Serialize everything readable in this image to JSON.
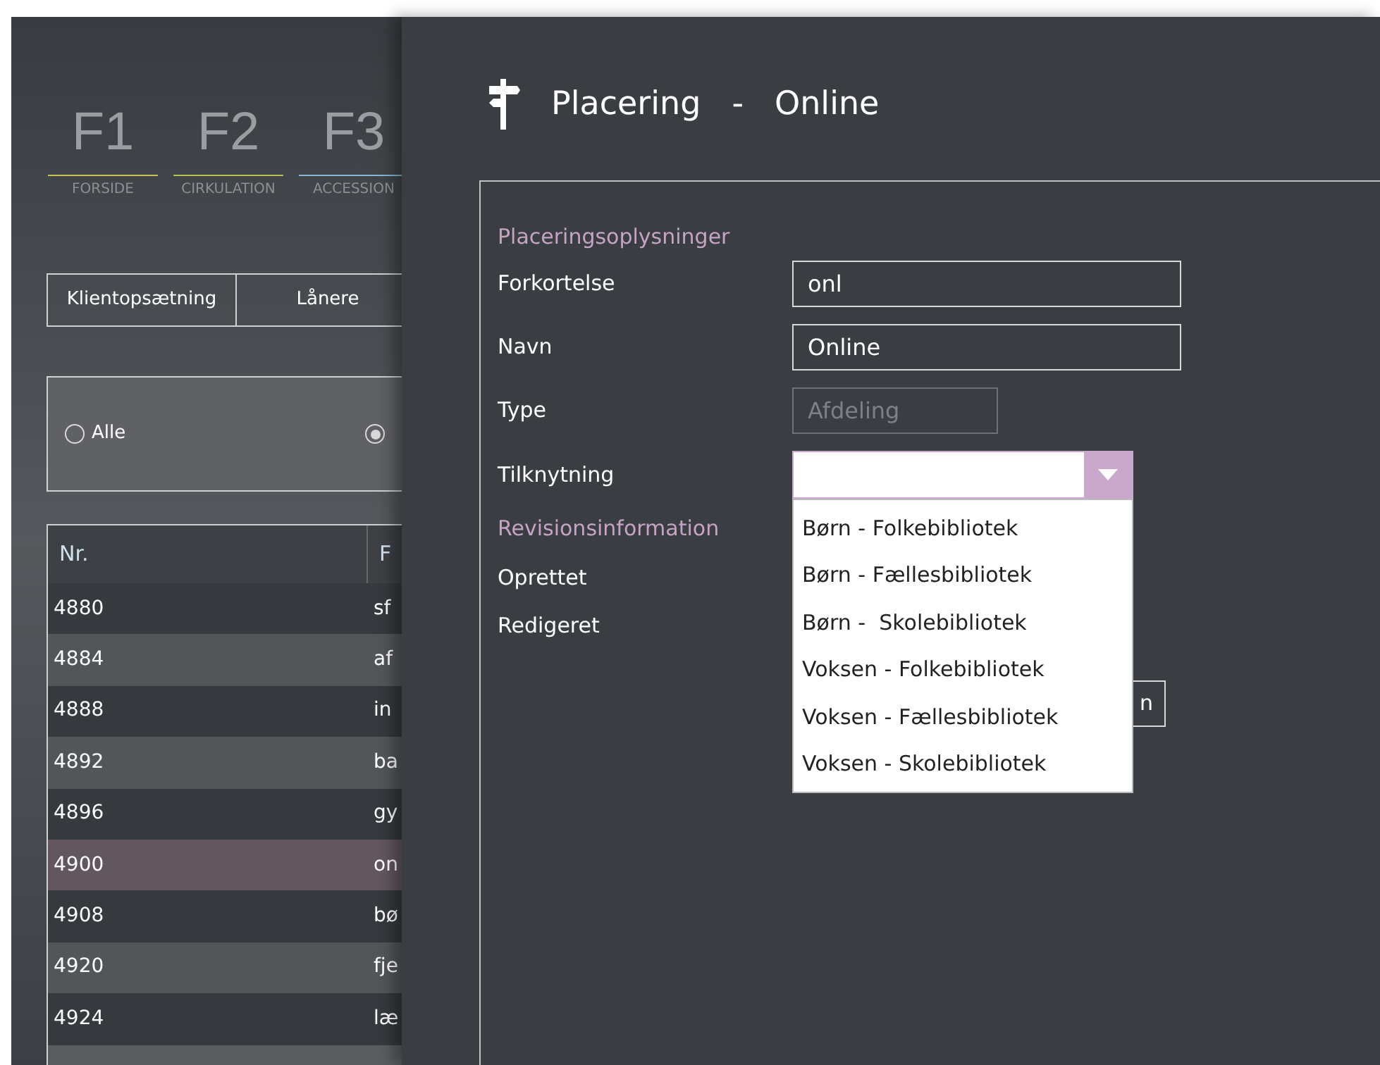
{
  "nav": {
    "keys": [
      {
        "key": "F1",
        "label": "FORSIDE",
        "color": "#c9c24f"
      },
      {
        "key": "F2",
        "label": "CIRKULATION",
        "color": "#b5c24a"
      },
      {
        "key": "F3",
        "label": "ACCESSION",
        "color": "#86b6d6"
      }
    ]
  },
  "tabs": [
    {
      "label": "Klientopsætning",
      "selected": false
    },
    {
      "label": "Lånere",
      "selected": false
    }
  ],
  "filter": [
    {
      "label": "Alle",
      "selected": false
    },
    {
      "selected": true
    }
  ],
  "table": {
    "columns": [
      "Nr.",
      "F"
    ],
    "rows": [
      {
        "cells": [
          "4880",
          "sf"
        ],
        "selected": false
      },
      {
        "cells": [
          "4884",
          "af"
        ],
        "selected": false
      },
      {
        "cells": [
          "4888",
          "in"
        ],
        "selected": false
      },
      {
        "cells": [
          "4892",
          "ba"
        ],
        "selected": false
      },
      {
        "cells": [
          "4896",
          "gy"
        ],
        "selected": false
      },
      {
        "cells": [
          "4900",
          "on"
        ],
        "selected": true
      },
      {
        "cells": [
          "4908",
          "bø"
        ],
        "selected": false
      },
      {
        "cells": [
          "4920",
          "fje"
        ],
        "selected": false
      },
      {
        "cells": [
          "4924",
          "læ"
        ],
        "selected": false
      }
    ]
  },
  "dialog": {
    "title": "Placering",
    "separator": "-",
    "subtitle": "Online",
    "section_1": "Placeringsoplysninger",
    "fields": [
      {
        "label": "Forkortelse",
        "kind": "text",
        "value": "onl"
      },
      {
        "label": "Navn",
        "kind": "text",
        "value": "Online"
      },
      {
        "label": "Type",
        "kind": "disabled",
        "value": "Afdeling"
      },
      {
        "label": "Tilknytning",
        "kind": "combo",
        "expanded": true,
        "options": [
          "Børn - Folkebibliotek",
          "Børn - Fællesbibliotek",
          "Børn -  Skolebibliotek",
          "Voksen - Folkebibliotek",
          "Voksen - Fællesbibliotek",
          "Voksen - Skolebibliotek"
        ]
      }
    ],
    "section_2": "Revisionsinformation",
    "revision": [
      "Oprettet",
      "Redigeret"
    ],
    "hidden_button": "n"
  }
}
